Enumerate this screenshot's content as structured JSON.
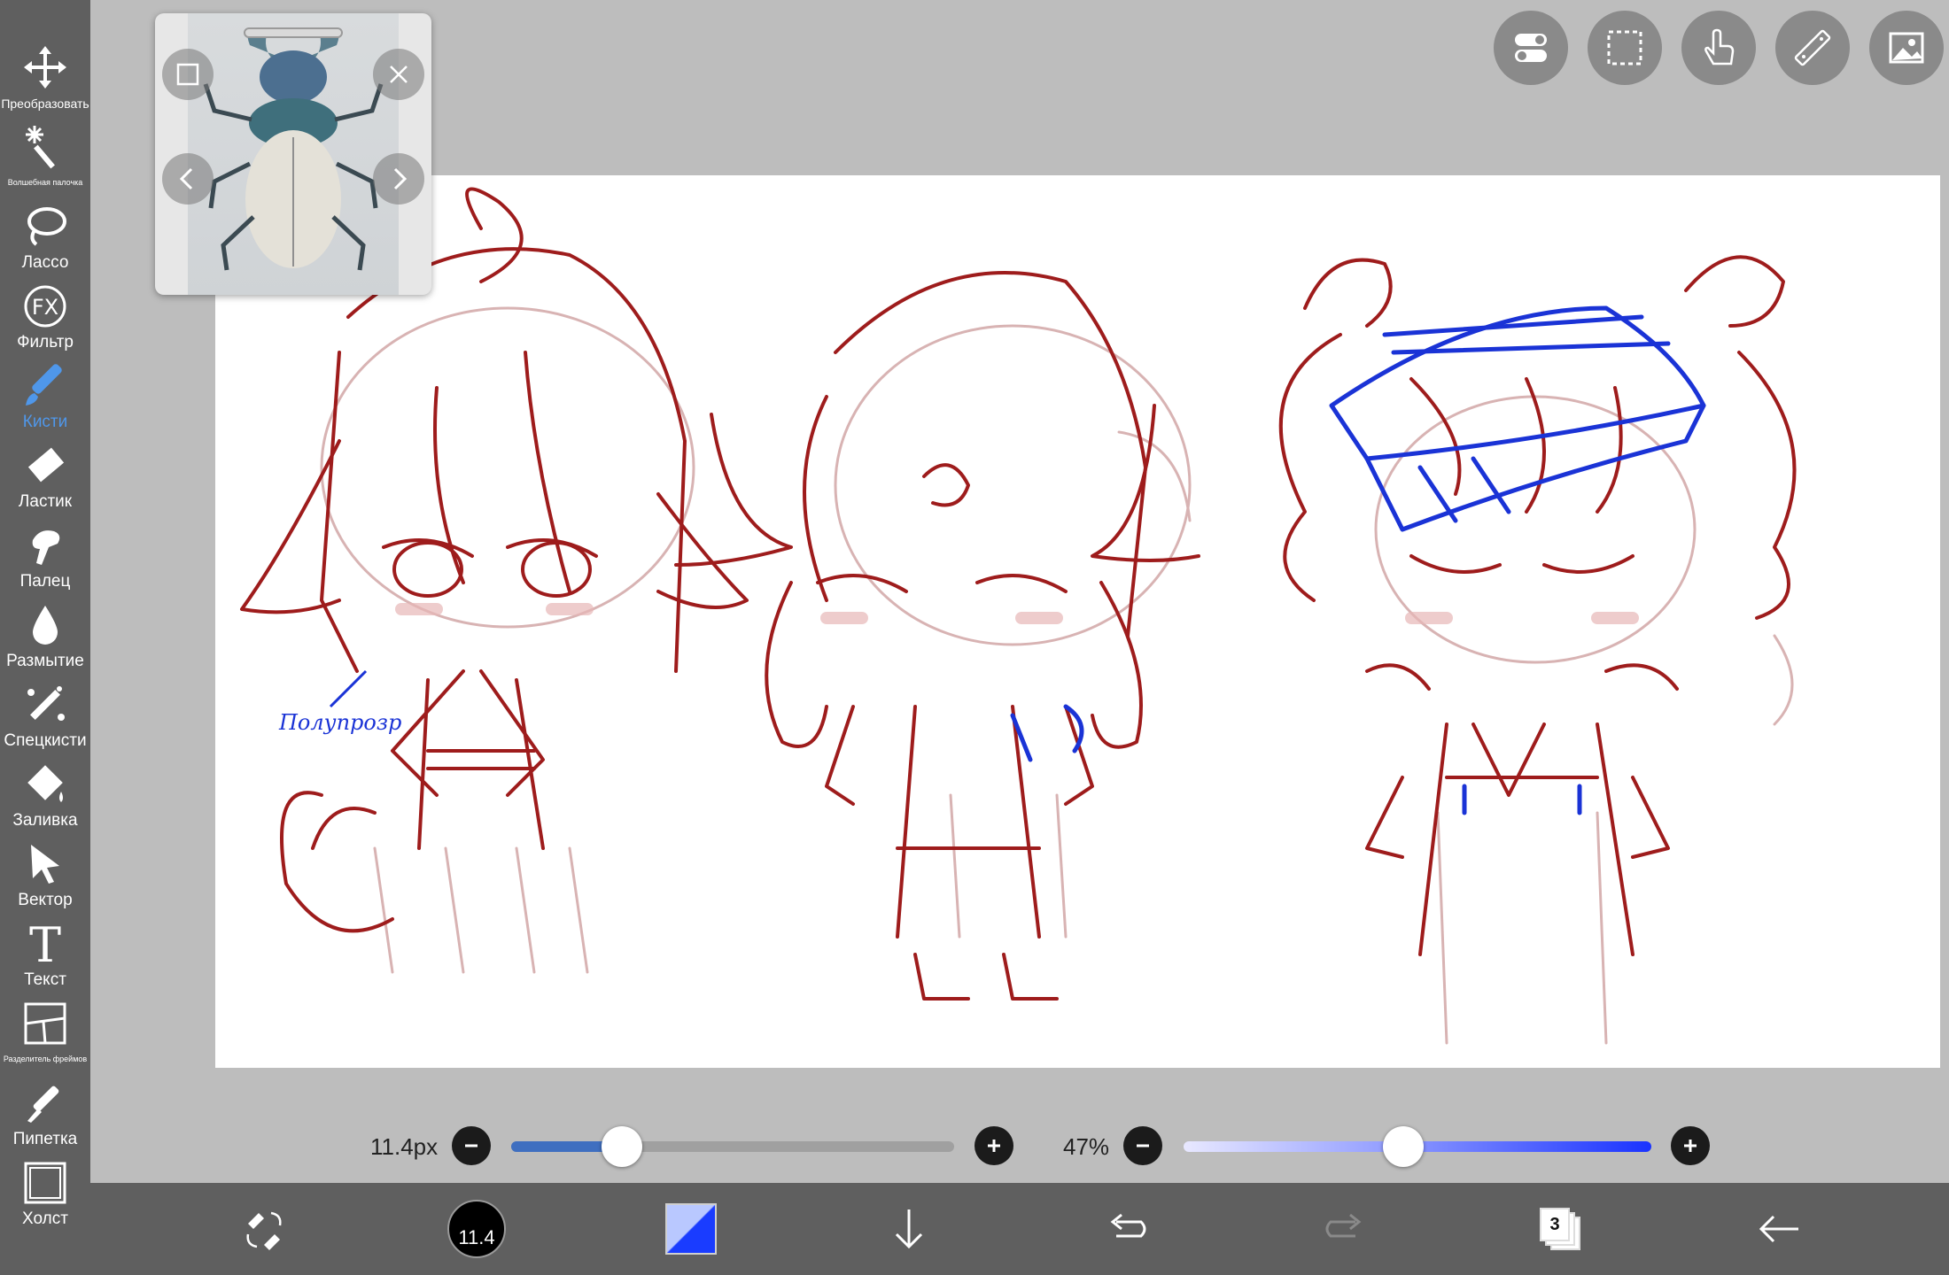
{
  "tools": [
    {
      "id": "transform",
      "label": "Преобразовать",
      "icon": "move-arrows-icon",
      "active": false
    },
    {
      "id": "magic-wand",
      "label": "Волшебная палочка",
      "icon": "magic-wand-icon",
      "active": false
    },
    {
      "id": "lasso",
      "label": "Лассо",
      "icon": "lasso-icon",
      "active": false
    },
    {
      "id": "filter",
      "label": "Фильтр",
      "icon": "fx-icon",
      "active": false
    },
    {
      "id": "brush",
      "label": "Кисти",
      "icon": "brush-icon",
      "active": true
    },
    {
      "id": "eraser",
      "label": "Ластик",
      "icon": "eraser-icon",
      "active": false
    },
    {
      "id": "finger",
      "label": "Палец",
      "icon": "finger-smudge-icon",
      "active": false
    },
    {
      "id": "blur",
      "label": "Размытие",
      "icon": "blur-drop-icon",
      "active": false
    },
    {
      "id": "special-brush",
      "label": "Спецкисти",
      "icon": "sparkle-brush-icon",
      "active": false
    },
    {
      "id": "fill",
      "label": "Заливка",
      "icon": "fill-bucket-icon",
      "active": false
    },
    {
      "id": "vector",
      "label": "Вектор",
      "icon": "pointer-arrow-icon",
      "active": false
    },
    {
      "id": "text",
      "label": "Текст",
      "icon": "text-t-icon",
      "active": false
    },
    {
      "id": "frame-divider",
      "label": "Разделитель фреймов",
      "icon": "frame-divider-icon",
      "active": false
    },
    {
      "id": "eyedropper",
      "label": "Пипетка",
      "icon": "eyedropper-icon",
      "active": false
    },
    {
      "id": "canvas",
      "label": "Холст",
      "icon": "canvas-square-icon",
      "active": false
    }
  ],
  "reference_window": {
    "image": "stag-beetle-reference-photo"
  },
  "top_buttons": [
    "toggle-settings-icon",
    "selection-rect-icon",
    "touch-hand-icon",
    "ruler-icon",
    "image-icon"
  ],
  "sliders": {
    "brush_size_label": "11.4px",
    "brush_size_fraction": 0.25,
    "opacity_label": "47%",
    "opacity_fraction": 0.47
  },
  "bottom_bar": {
    "brush_size_value": "11.4",
    "layer_count": "3",
    "current_color": "#1a3cff"
  },
  "canvas": {
    "annotation_text": "Полупрозр"
  },
  "colors": {
    "sidebar": "#5f5f5f",
    "active_tool": "#4f97ea",
    "sketch_red": "#9e1c1c",
    "sketch_blue": "#1a33d6",
    "sketch_pink": "#d8b3b3"
  }
}
